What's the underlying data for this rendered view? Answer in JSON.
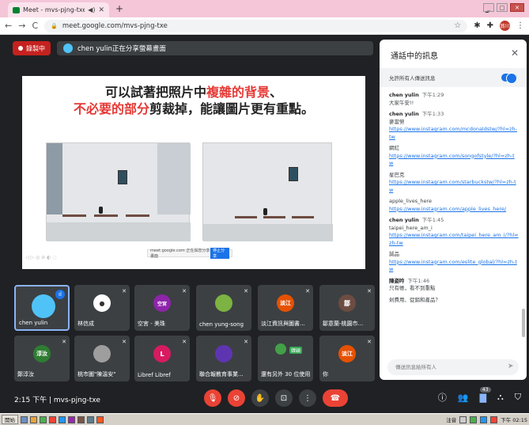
{
  "browser": {
    "tab_title": "Meet - mvs-pjng-txe",
    "speaker_icon": "speaker-icon",
    "new_tab": "+",
    "url": "meet.google.com/mvs-pjng-txe",
    "profile_initials": "翁川"
  },
  "meet": {
    "recording_label": "錄製中",
    "presenting_label": "chen yulin正在分享螢幕畫面",
    "slide": {
      "line1_pre": "可以試著把照片中",
      "line1_red": "複雜的背景",
      "line1_post": "、",
      "line2_red": "不必要的部分",
      "line2_post": "剪裁掉，能讓圖片更有重點。",
      "footer_text": "meet.google.com 正在與您分享畫面",
      "footer_button": "停止分享"
    },
    "tiles": [
      {
        "name": "chen yulin",
        "initial": "",
        "color": "#4fc3f7"
      },
      {
        "name": "林信成",
        "initial": "",
        "color": "#ffffff"
      },
      {
        "name": "空宮 - 美珠",
        "initial": "空宮",
        "color": "#8e24aa"
      },
      {
        "name": "chen yung-song",
        "initial": "",
        "color": "#7cb342"
      },
      {
        "name": "淡江資訊與圖書...",
        "initial": "淡江",
        "color": "#e65100"
      },
      {
        "name": "鄒意蘭-桃園市...",
        "initial": "鄒",
        "color": "#6d4c41"
      },
      {
        "name": "鄭淳汝",
        "initial": "淳汝",
        "color": "#2e7d32"
      },
      {
        "name": "桃市圖\"陳溫安\"",
        "initial": "",
        "color": "#9e9e9e"
      },
      {
        "name": "Libref Libref",
        "initial": "L",
        "color": "#d81b60"
      },
      {
        "name": "聯合報教育事業...",
        "initial": "",
        "color": "#5e35b1"
      },
      {
        "name": "還有另外 30 位使用者",
        "initial": "",
        "color": "#43a047"
      },
      {
        "name": "你",
        "initial": "淡江",
        "color": "#e65100"
      }
    ],
    "tile_badge": "韓穎",
    "meeting_time": "2:15 下午",
    "meeting_code": "mvs-pjng-txe",
    "participant_count": "43"
  },
  "chat": {
    "title": "通話中的訊息",
    "allow_label": "允許所有人傳送訊息",
    "messages": [
      {
        "sender": "chen yulin",
        "time": "下午1:29",
        "text": "大家午安!!",
        "link": ""
      },
      {
        "sender": "chen yulin",
        "time": "下午1:33",
        "text": "麥當勞",
        "link": "https://www.instagram.com/mcdonaldstw/?hl=zh-tw"
      },
      {
        "sender": "",
        "time": "",
        "text": "網紅",
        "link": "https://www.instagram.com/songofstyle/?hl=zh-tw"
      },
      {
        "sender": "",
        "time": "",
        "text": "星巴克",
        "link": "https://www.instagram.com/starbuckstw/?hl=zh-tw"
      },
      {
        "sender": "",
        "time": "",
        "text": "apple_lives_here",
        "link": "https://www.instagram.com/apple_lives_here/"
      },
      {
        "sender": "chen yulin",
        "time": "下午1:45",
        "text": "taipei_here_am_i",
        "link": "https://www.instagram.com/taipei_here_am_i/?hl=zh-tw"
      },
      {
        "sender": "",
        "time": "",
        "text": "誠品",
        "link": "https://www.instagram.com/eslite_global/?hl=zh-tw"
      },
      {
        "sender": "陳姿吟",
        "time": "下午1:46",
        "text": "只有帳，看不到重點",
        "link": ""
      },
      {
        "sender": "",
        "time": "",
        "text": "剁費用、促銷和產品？",
        "link": ""
      }
    ],
    "input_placeholder": "傳送訊息給所有人"
  },
  "taskbar": {
    "start_label": "開始",
    "tray_lang": "注音",
    "clock": "下午 02:15"
  }
}
